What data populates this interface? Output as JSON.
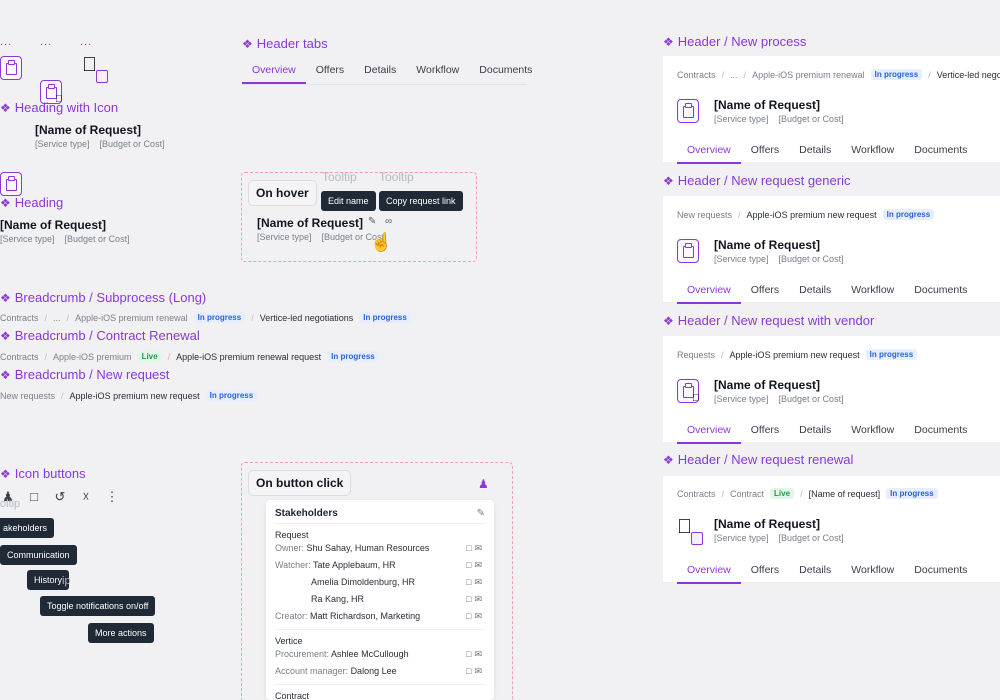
{
  "left": {
    "dots": "...",
    "heading_with_icon": {
      "section": "Heading with Icon",
      "title": "[Name of Request]",
      "meta": [
        "[Service type]",
        "[Budget or Cost]"
      ]
    },
    "heading": {
      "section": "Heading",
      "title": "[Name of Request]",
      "meta": [
        "[Service type]",
        "[Budget or Cost]"
      ]
    },
    "breadcrumb_subprocess": {
      "section": "Breadcrumb / Subprocess (Long)",
      "items": [
        "Contracts",
        "...",
        "Apple-iOS premium renewal"
      ],
      "badge": "In progress",
      "tail": "Vertice-led negotiations",
      "tail_badge": "In progress"
    },
    "breadcrumb_contract": {
      "section": "Breadcrumb / Contract Renewal",
      "items": [
        "Contracts",
        "Apple-iOS premium"
      ],
      "badge_live": "Live",
      "tail": "Apple-iOS premium renewal request",
      "tail_badge": "In progress"
    },
    "breadcrumb_new": {
      "section": "Breadcrumb / New request",
      "items": [
        "New requests"
      ],
      "tail": "Apple-iOS premium new request",
      "tail_badge": "In progress"
    },
    "icon_buttons": {
      "section": "Icon buttons",
      "ghost": "oltip",
      "ghost2": "ip",
      "tooltips": [
        "akeholders",
        "Communication",
        "History",
        "Toggle notifications on/off",
        "More actions"
      ]
    }
  },
  "middle": {
    "header_tabs": {
      "section": "Header tabs",
      "tabs": [
        "Overview",
        "Offers",
        "Details",
        "Workflow",
        "Documents"
      ]
    },
    "hover": {
      "chip": "On hover",
      "ghost1": "Tooltip",
      "ghost2": "Tooltip",
      "tip_edit": "Edit name",
      "tip_copy": "Copy request link",
      "title": "[Name of Request]",
      "meta": [
        "[Service type]",
        "[Budget or Cost]"
      ]
    },
    "click": {
      "chip": "On button click",
      "panel_title": "Stakeholders",
      "groups": [
        {
          "name": "Request",
          "rows": [
            {
              "label": "Owner:",
              "value": "Shu Sahay, Human Resources"
            },
            {
              "label": "Watcher:",
              "value": "Tate Applebaum, HR"
            },
            {
              "label": "",
              "value": "Amelia Dimoldenburg, HR"
            },
            {
              "label": "",
              "value": "Ra Kang, HR"
            },
            {
              "label": "Creator:",
              "value": "Matt Richardson, Marketing"
            }
          ]
        },
        {
          "name": "Vertice",
          "rows": [
            {
              "label": "Procurement:",
              "value": "Ashlee McCullough"
            },
            {
              "label": "Account manager:",
              "value": "Dalong Lee"
            }
          ]
        }
      ],
      "partial_group": "Contract"
    }
  },
  "right": {
    "tabs": [
      "Overview",
      "Offers",
      "Details",
      "Workflow",
      "Documents"
    ],
    "title": "[Name of Request]",
    "meta": [
      "[Service type]",
      "[Budget or Cost]"
    ],
    "new_process": {
      "section": "Header / New process",
      "crumbs": [
        "Contracts",
        "...",
        "Apple-iOS premium renewal"
      ],
      "badge": "In progress",
      "tail": "Vertice-led negotiati"
    },
    "new_generic": {
      "section": "Header / New request generic",
      "crumbs": [
        "New requests",
        "Apple-iOS premium new request"
      ],
      "badge": "In progress"
    },
    "new_vendor": {
      "section": "Header / New request with vendor",
      "crumbs": [
        "Requests",
        "Apple-iOS premium new request"
      ],
      "badge": "In progress"
    },
    "renewal": {
      "section": "Header / New request renewal",
      "crumbs": [
        "Contracts",
        "Contract"
      ],
      "badge_live": "Live",
      "tail": "[Name of request]",
      "badge": "In progress"
    }
  }
}
